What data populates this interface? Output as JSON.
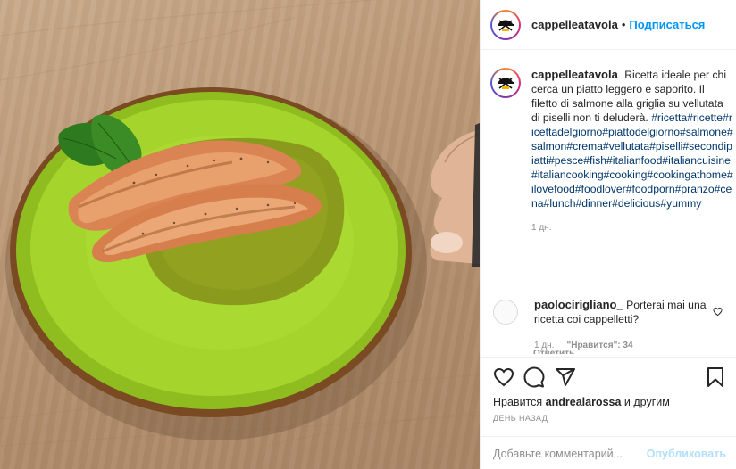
{
  "post": {
    "author": "cappelleatavola",
    "separator": "•",
    "follow_label": "Подписаться",
    "caption_text": "Ricetta ideale per chi cerca un piatto leggero e saporito. Il filetto di salmone alla griglia su vellutata di piselli non ti deluderà.",
    "hashtags": "#ricetta#ricette#ricettadelgiorno#piattodelgiorno#salmone#salmon#crema#vellutata#piselli#secondipiatti#pesce#fish#italianfood#italiancuisine#italiancooking#cooking#cookingathome#ilovefood#foodlover#foodporn#pranzo#cena#lunch#dinner#delicious#yummy",
    "timestamp": "1 дн."
  },
  "comment": {
    "author": "paolocirigliano_",
    "text": "Porterai mai una ricetta coi cappelletti?",
    "time": "1 дн.",
    "likes": "\"Нравится\": 34",
    "reply": "Ответить"
  },
  "actions": {
    "likes_prefix": "Нравится",
    "likes_user": "andrealarossa",
    "likes_suffix": "и другим",
    "date": "ДЕНЬ НАЗАД"
  },
  "compose": {
    "placeholder": "Добавьте комментарий...",
    "publish_label": "Опубликовать"
  },
  "colors": {
    "accent": "#0095f6",
    "hashtag": "#00376b",
    "publish_disabled": "#b2dffc",
    "muted": "#8e8e8e"
  },
  "icons": [
    "heart-icon",
    "comment-icon",
    "share-icon",
    "bookmark-icon",
    "like-comment-icon"
  ]
}
